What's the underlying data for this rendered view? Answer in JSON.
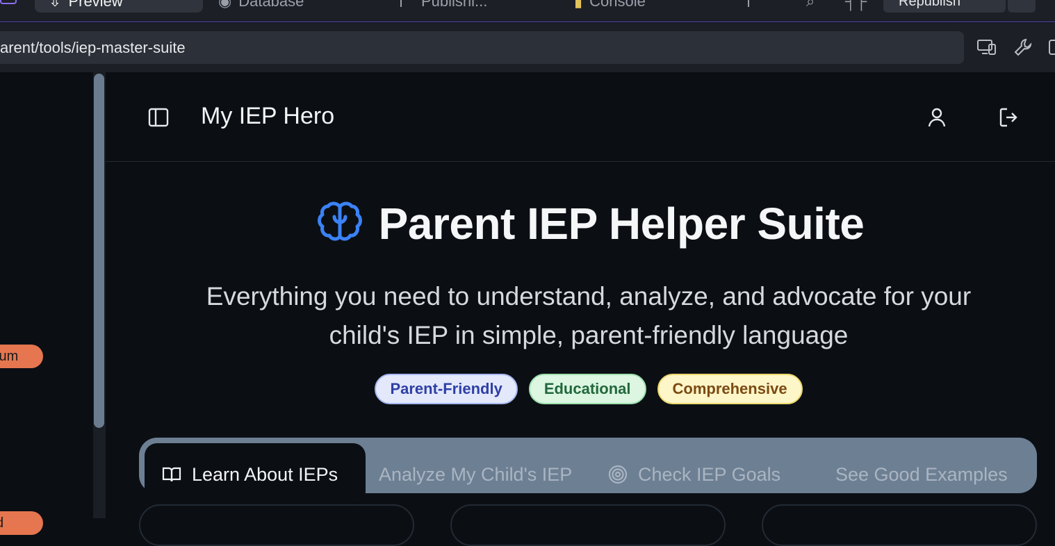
{
  "ide": {
    "tabs": [
      {
        "label": "Preview",
        "icon": "preview-icon"
      },
      {
        "label": "Database",
        "icon": "database-icon"
      },
      {
        "label": "Publishi...",
        "icon": "publish-icon"
      },
      {
        "label": "Console",
        "icon": "console-icon"
      }
    ],
    "republish_label": "Republish",
    "url": "arent/tools/iep-master-suite"
  },
  "left_pane": {
    "pill_1": "ium",
    "pill_2": "d"
  },
  "app": {
    "brand": "My IEP Hero",
    "hero_title": "Parent IEP Helper Suite",
    "subtitle_line1": "Everything you need to understand, analyze, and advocate for your",
    "subtitle_line2": "child's IEP in simple, parent-friendly language",
    "badges": [
      {
        "label": "Parent-Friendly",
        "color": "#e3e9fb"
      },
      {
        "label": "Educational",
        "color": "#dcf6e2"
      },
      {
        "label": "Comprehensive",
        "color": "#fdf6c9"
      }
    ],
    "tabs": [
      {
        "label": "Learn About IEPs",
        "icon": "book-open-icon",
        "active": true
      },
      {
        "label": "Analyze My Child's IEP",
        "icon": "",
        "active": false
      },
      {
        "label": "Check IEP Goals",
        "icon": "target-icon",
        "active": false
      },
      {
        "label": "See Good Examples",
        "icon": "",
        "active": false
      }
    ],
    "accent_color": "#3b82f6"
  }
}
